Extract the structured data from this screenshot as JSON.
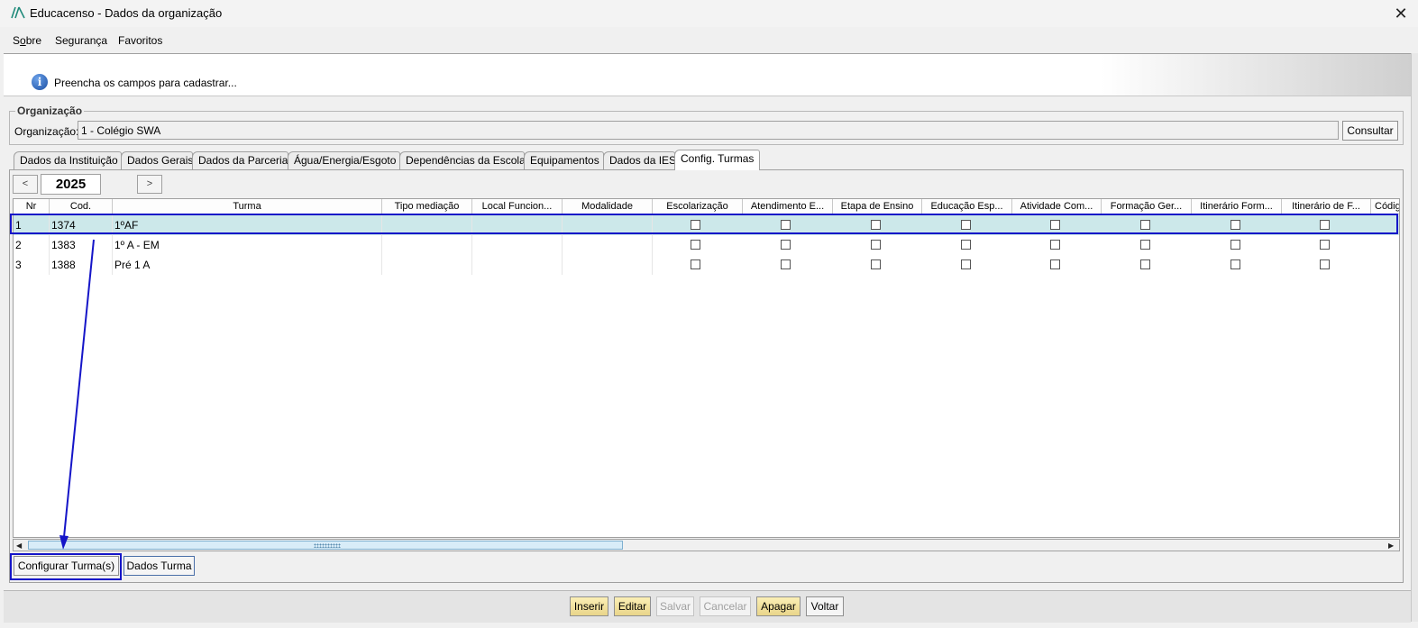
{
  "window": {
    "title": "Educacenso - Dados da organização",
    "close_glyph": "✕"
  },
  "menu": [
    {
      "label": "Sobre",
      "mnemonic_index": 1
    },
    {
      "label": "Segurança"
    },
    {
      "label": "Favoritos"
    }
  ],
  "info": {
    "glyph": "i",
    "text": "Preencha os campos para cadastrar..."
  },
  "organization": {
    "legend": "Organização",
    "label": "Organização:",
    "value": "1 - Colégio SWA",
    "consultar_label": "Consultar"
  },
  "tabs": [
    {
      "label": "Dados da Instituição",
      "active": false
    },
    {
      "label": "Dados Gerais",
      "active": false
    },
    {
      "label": "Dados da Parceria",
      "active": false
    },
    {
      "label": "Água/Energia/Esgoto",
      "active": false
    },
    {
      "label": "Dependências da Escola",
      "active": false
    },
    {
      "label": "Equipamentos",
      "active": false
    },
    {
      "label": "Dados da IES",
      "active": false
    },
    {
      "label": "Config. Turmas",
      "active": true
    }
  ],
  "year_nav": {
    "prev_glyph": "<",
    "next_glyph": ">",
    "year": "2025"
  },
  "table": {
    "columns": [
      "Nr",
      "Cod.",
      "Turma",
      "Tipo mediação",
      "Local Funcion...",
      "Modalidade",
      "Escolarização",
      "Atendimento E...",
      "Etapa de Ensino",
      "Educação Esp...",
      "Atividade Com...",
      "Formação Ger...",
      "Itinerário Form...",
      "Itinerário de F...",
      "Códig"
    ],
    "rows": [
      {
        "nr": "1",
        "cod": "1374",
        "turma": "1ºAF",
        "selected": true
      },
      {
        "nr": "2",
        "cod": "1383",
        "turma": "1º A - EM",
        "selected": false
      },
      {
        "nr": "3",
        "cod": "1388",
        "turma": "Pré 1 A",
        "selected": false
      }
    ],
    "scroll_left_glyph": "◀",
    "scroll_right_glyph": "▶"
  },
  "panel_buttons": {
    "configurar": "Configurar Turma(s)",
    "dados_turma": "Dados Turma"
  },
  "actions": [
    {
      "label": "Inserir",
      "style": "yellow"
    },
    {
      "label": "Editar",
      "style": "yellow"
    },
    {
      "label": "Salvar",
      "style": "disabled"
    },
    {
      "label": "Cancelar",
      "style": "disabled"
    },
    {
      "label": "Apagar",
      "style": "yellow"
    },
    {
      "label": "Voltar",
      "style": "normal"
    }
  ],
  "colors": {
    "annotation": "#1515c8",
    "selected_row": "#cce8ea",
    "logo": "#1f8a7a"
  },
  "icons": {
    "app": "app-logo-icon",
    "info": "info-icon",
    "close": "close-icon"
  }
}
